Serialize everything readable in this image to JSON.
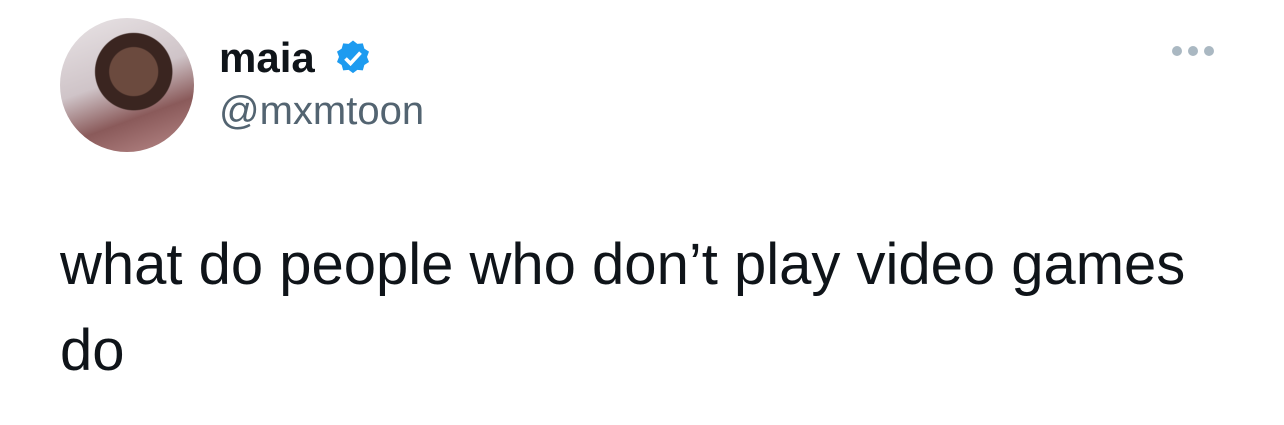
{
  "author": {
    "name": "maia",
    "handle": "@mxmtoon",
    "verified": true,
    "verified_color": "#1d9bf0"
  },
  "tweet": {
    "text": "what do people who don’t play video games do"
  },
  "icons": {
    "more": "more-horizontal-icon"
  }
}
